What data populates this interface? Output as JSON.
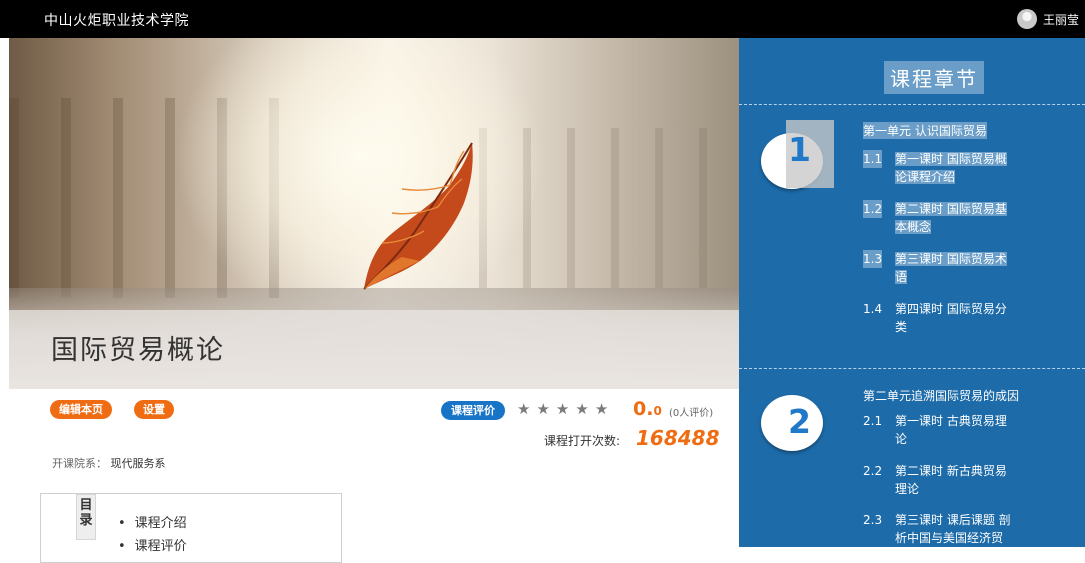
{
  "topbar": {
    "brand": "中山火炬职业技术学院",
    "user_name": "王丽莹"
  },
  "course": {
    "title": "国际贸易概论",
    "buttons": {
      "edit": "编辑本页",
      "settings": "设置",
      "evaluate": "课程评价"
    },
    "rating": {
      "stars": 5,
      "value_main": "0.",
      "value_decimal": "0",
      "count_text": "(0人评价)"
    },
    "open_label": "课程打开次数:",
    "open_count": "168488",
    "dept_label": "开课院系：",
    "dept_value": "现代服务系"
  },
  "toc": {
    "tag": "目录",
    "items": [
      "课程介绍",
      "课程评价"
    ]
  },
  "sidebar": {
    "title": "课程章节",
    "units": [
      {
        "number": "1",
        "title": "第一单元 认识国际贸易",
        "lessons": [
          {
            "num": "1.1",
            "line1": "第一课时 国际贸易概",
            "line2": "论课程介绍"
          },
          {
            "num": "1.2",
            "line1": "第二课时 国际贸易基",
            "line2": "本概念"
          },
          {
            "num": "1.3",
            "line1": "第三课时 国际贸易术",
            "line2": "语"
          },
          {
            "num": "1.4",
            "line1": "第四课时 国际贸易分",
            "line2": "类"
          }
        ]
      },
      {
        "number": "2",
        "title": "第二单元追溯国际贸易的成因",
        "lessons": [
          {
            "num": "2.1",
            "line1": "第一课时 古典贸易理",
            "line2": "论"
          },
          {
            "num": "2.2",
            "line1": "第二课时 新古典贸易",
            "line2": "理论"
          },
          {
            "num": "2.3",
            "line1": "第三课时 课后课题 剖",
            "line2": "析中国与美国经济贸"
          }
        ]
      }
    ]
  }
}
